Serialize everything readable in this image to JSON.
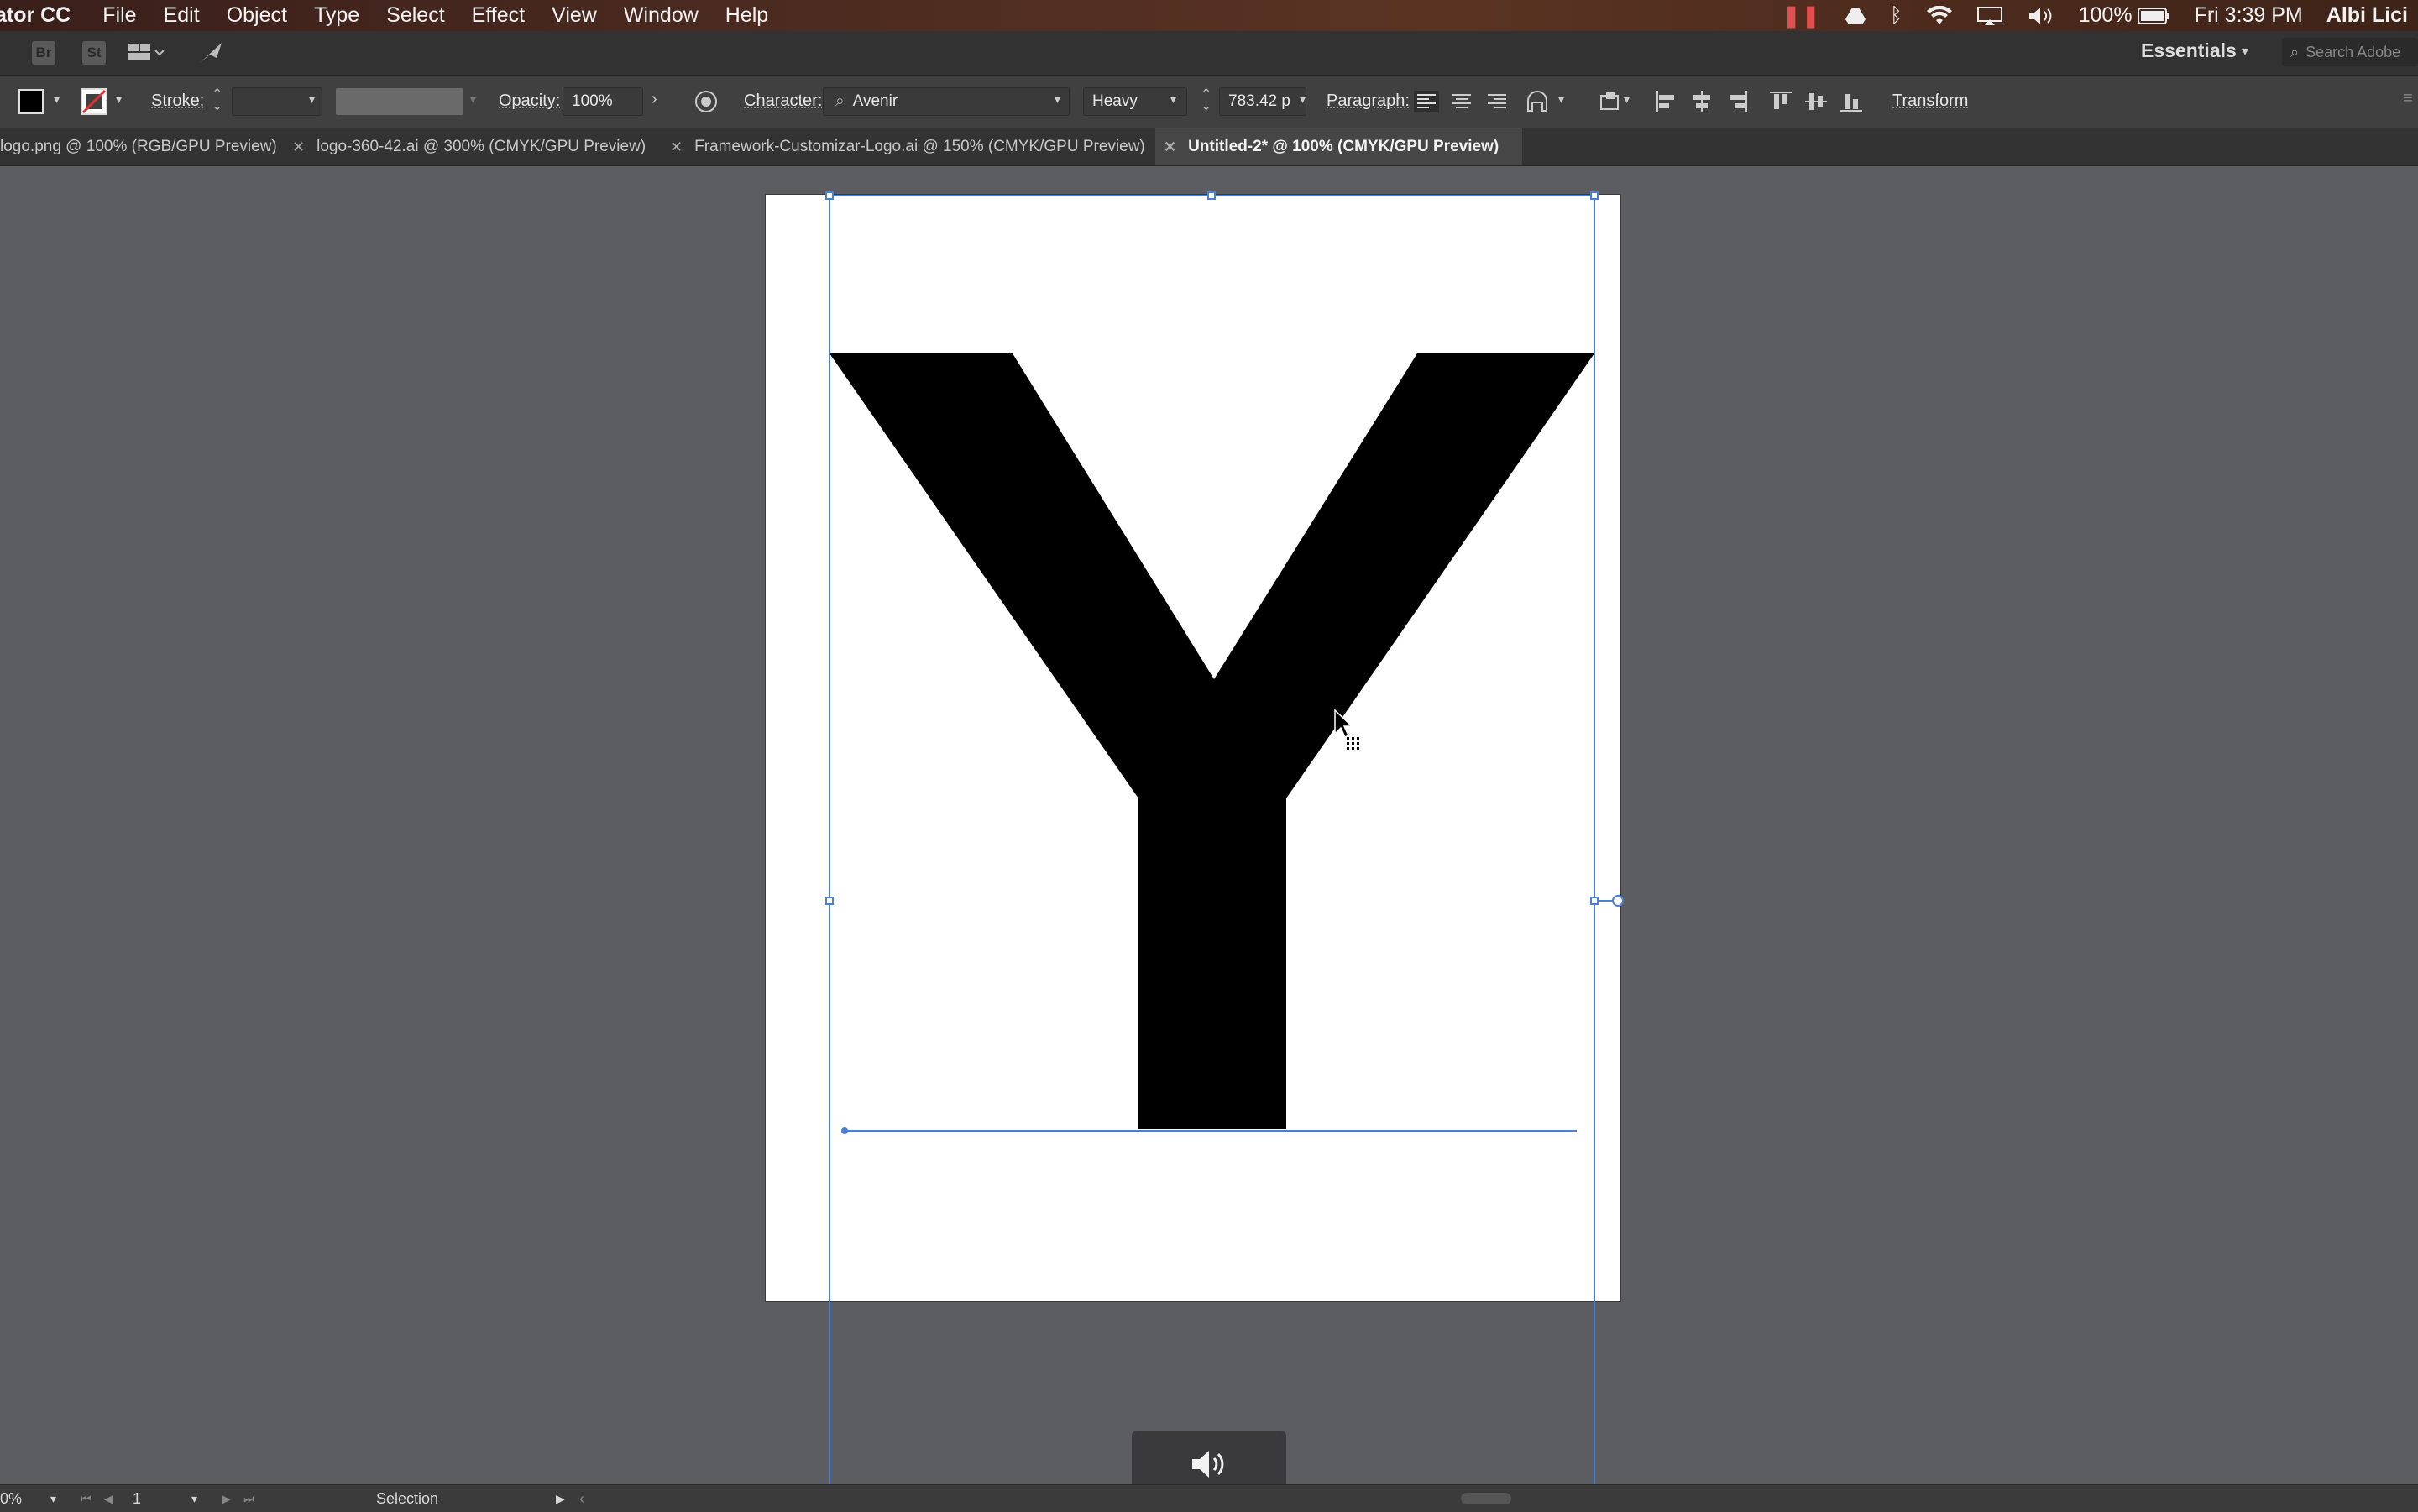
{
  "menubar": {
    "app_name": "ator CC",
    "items": [
      "File",
      "Edit",
      "Object",
      "Type",
      "Select",
      "Effect",
      "View",
      "Window",
      "Help"
    ],
    "battery": "100%",
    "clock": "Fri 3:39 PM",
    "user": "Albi Lici"
  },
  "appbar": {
    "bridge": "Br",
    "stock": "St",
    "workspace": "Essentials",
    "search_placeholder": "Search Adobe"
  },
  "control": {
    "stroke_label": "Stroke:",
    "opacity_label": "Opacity:",
    "opacity_value": "100%",
    "character_label": "Character:",
    "font_family": "Avenir",
    "font_style": "Heavy",
    "font_size": "783.42 p",
    "paragraph_label": "Paragraph:",
    "transform_label": "Transform"
  },
  "tabs": [
    {
      "label": "logo.png @ 100% (RGB/GPU Preview)",
      "active": false
    },
    {
      "label": "logo-360-42.ai @ 300% (CMYK/GPU Preview)",
      "active": false
    },
    {
      "label": "Framework-Customizar-Logo.ai @ 150% (CMYK/GPU Preview)",
      "active": false
    },
    {
      "label": "Untitled-2* @ 100% (CMYK/GPU Preview)",
      "active": true
    }
  ],
  "canvas": {
    "glyph_text": "Y",
    "glyph_color": "#000000",
    "selection_color": "#4a7fd6"
  },
  "status": {
    "zoom": "0%",
    "artboard_number": "1",
    "tool": "Selection"
  },
  "colors": {
    "menubar_text": "#f2f2f2",
    "panel_bg": "#404040",
    "canvas_bg": "#5c5d61",
    "recording_indicator": "#e05050"
  }
}
